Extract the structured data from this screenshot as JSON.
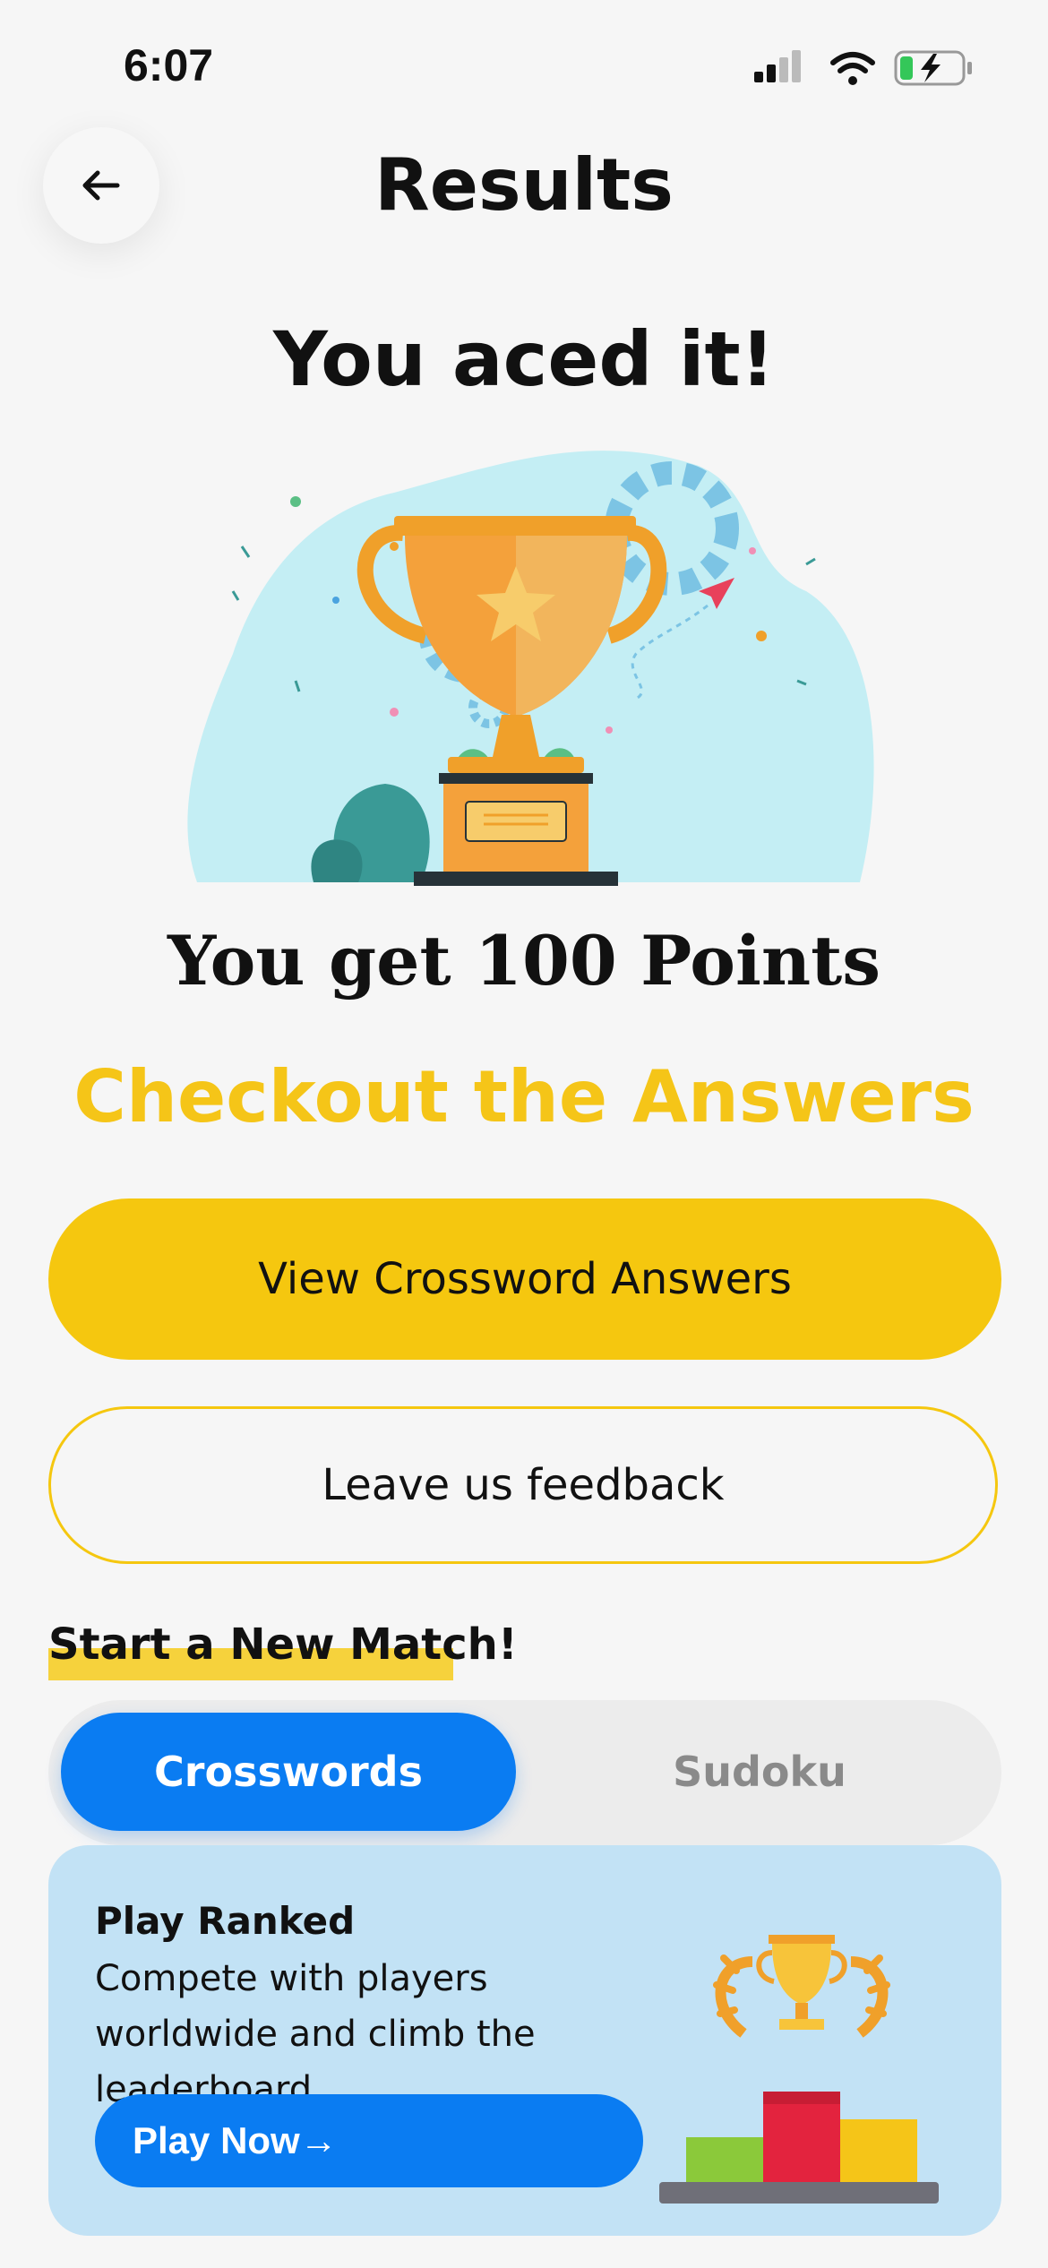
{
  "status_bar": {
    "time": "6:07"
  },
  "header": {
    "title": "Results"
  },
  "result": {
    "headline": "You aced it!",
    "points_text": "You get 100 Points",
    "checkout_title": "Checkout the Answers"
  },
  "actions": {
    "view_answers": "View Crossword Answers",
    "feedback": "Leave us feedback"
  },
  "new_match": {
    "title": "Start a New Match!",
    "tabs": [
      {
        "label": "Crosswords",
        "selected": true
      },
      {
        "label": "Sudoku",
        "selected": false
      }
    ]
  },
  "card": {
    "title": "Play Ranked",
    "description": "Compete with players worldwide and climb the leaderboard.",
    "button": "Play Now→"
  },
  "colors": {
    "accent_yellow": "#f5c70f",
    "primary_blue": "#0a7cf2",
    "card_bg": "#c2e2f5",
    "page_bg": "#f6f6f6"
  },
  "icons": [
    "back-arrow-icon",
    "signal-icon",
    "wifi-icon",
    "battery-charging-icon",
    "trophy-illustration",
    "podium-illustration"
  ]
}
